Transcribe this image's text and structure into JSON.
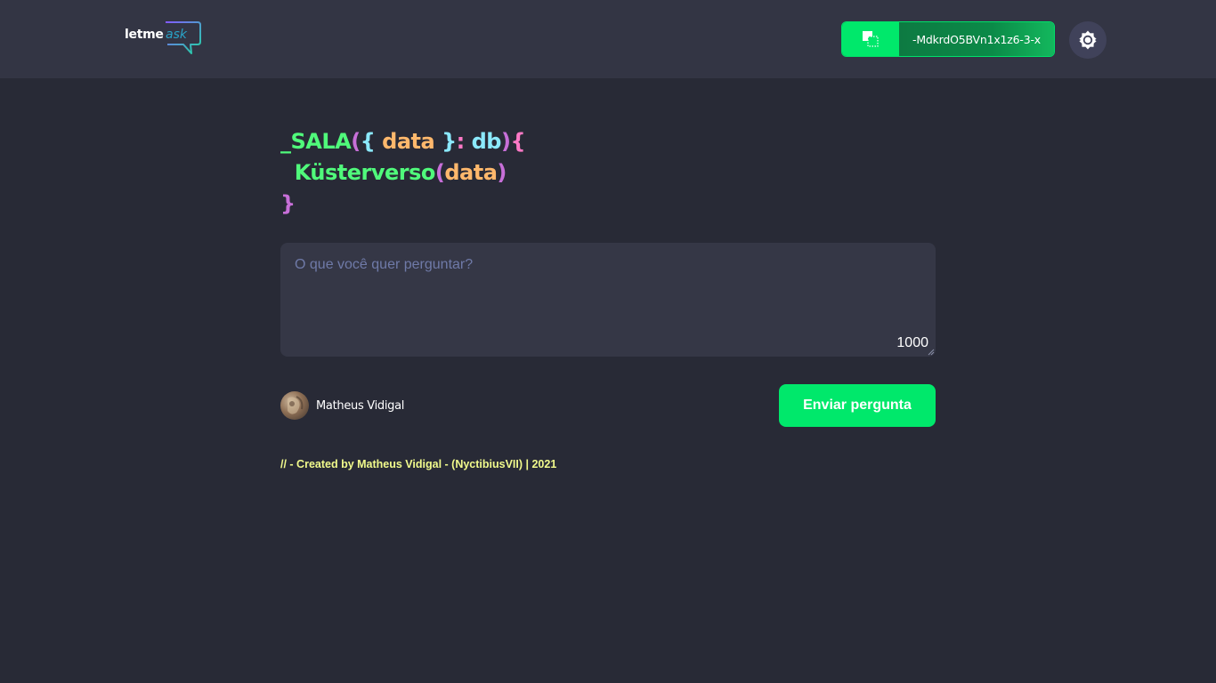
{
  "header": {
    "logo": {
      "part1": "letme",
      "part2": "ask"
    },
    "room_code": "-MdkrdO5BVn1x1z6-3-x",
    "copy_icon": "copy-icon",
    "theme_icon": "sun-icon"
  },
  "room_title": {
    "line1": {
      "underscore": "_",
      "keyword": "SALA",
      "open_paren": "(",
      "open_brace": "{",
      "param": "data",
      "close_brace": "}",
      "colon": ":",
      "type": "db",
      "close_paren": ")",
      "block_open": "{"
    },
    "line2": {
      "name": "Küsterverso",
      "open_paren": "(",
      "arg": "data",
      "close_paren": ")"
    },
    "line3": {
      "block_close": "}"
    }
  },
  "question_form": {
    "placeholder": "O que você quer perguntar?",
    "value": "",
    "char_limit": "1000",
    "user_name": "Matheus Vidigal",
    "submit_label": "Enviar pergunta"
  },
  "footer": {
    "text": "// - Created by Matheus Vidigal - (NyctibiusVII) | 2021"
  },
  "colors": {
    "background": "#282a36",
    "header": "#333544",
    "accent_green": "#00e86b",
    "footer_text": "#f1fa8c"
  }
}
